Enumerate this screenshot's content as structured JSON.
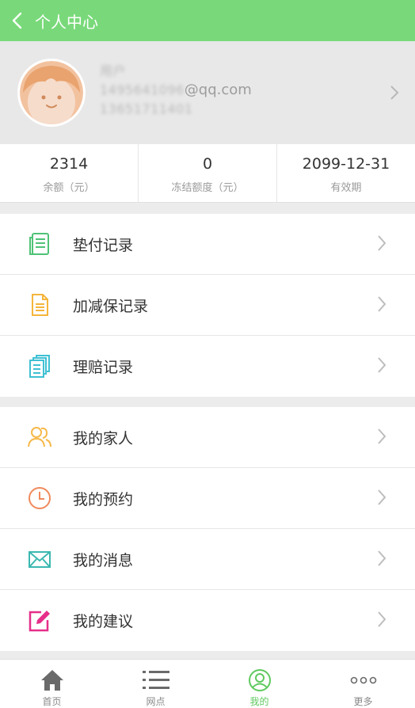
{
  "header": {
    "title": "个人中心",
    "back_icon": "chevron-left-icon",
    "background": "#79d97a"
  },
  "profile": {
    "name_masked": "用户",
    "email_masked": "1495641096",
    "email_domain": "@qq.com",
    "phone_masked": "13651711401"
  },
  "stats": [
    {
      "value": "2314",
      "label": "余额（元）"
    },
    {
      "value": "0",
      "label": "冻结额度（元）"
    },
    {
      "value": "2099-12-31",
      "label": "有效期"
    }
  ],
  "menu_group_1": [
    {
      "label": "垫付记录",
      "icon": "document-list-icon"
    },
    {
      "label": "加减保记录",
      "icon": "notepad-icon"
    },
    {
      "label": "理赔记录",
      "icon": "copy-documents-icon"
    }
  ],
  "menu_group_2": [
    {
      "label": "我的家人",
      "icon": "people-icon"
    },
    {
      "label": "我的预约",
      "icon": "clock-icon"
    },
    {
      "label": "我的消息",
      "icon": "envelope-icon"
    },
    {
      "label": "我的建议",
      "icon": "edit-icon"
    }
  ],
  "tabbar": [
    {
      "label": "首页",
      "icon": "home-icon"
    },
    {
      "label": "网点",
      "icon": "list-icon"
    },
    {
      "label": "我的",
      "icon": "user-icon",
      "active": true
    },
    {
      "label": "更多",
      "icon": "more-icon"
    }
  ],
  "colors": {
    "accent": "#79d97a",
    "active_tab": "#5fc95f"
  }
}
